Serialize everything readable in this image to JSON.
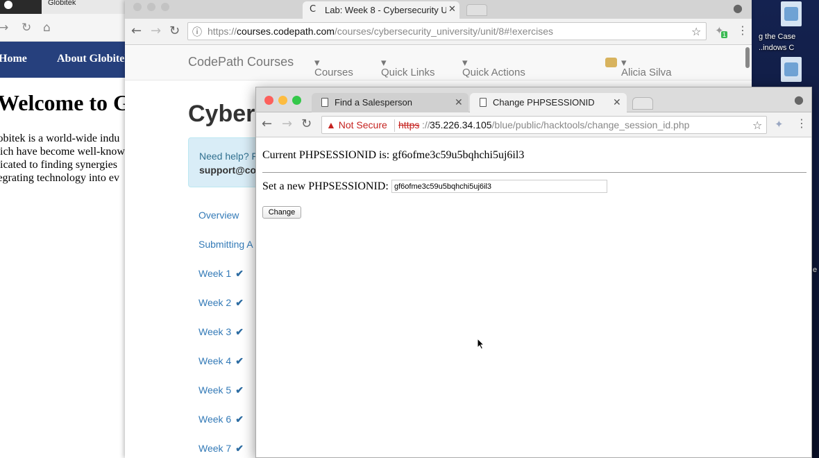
{
  "globitek": {
    "tab_title": "Globitek",
    "nav_home": "Home",
    "nav_about": "About Globitek",
    "heading": "Welcome to G",
    "paragraph_lines": [
      "lobitek is a world-wide indu",
      "hich have become well-know",
      "dicated to finding synergies",
      "tegrating technology into ev"
    ]
  },
  "codepath": {
    "tab_title": "Lab: Week 8 - Cybersecurity U",
    "url_prefix": "https://",
    "url_host": "courses.codepath.com",
    "url_path": "/courses/cybersecurity_university/unit/8#!exercises",
    "extension_badge": "1",
    "nav": {
      "brand": "CodePath Courses",
      "courses": "Courses",
      "quick_links": "Quick Links",
      "quick_actions": "Quick Actions",
      "user": "Alicia Silva"
    },
    "page_title": "Cyber",
    "help_line1": "Need help? F",
    "help_line2": "support@coc",
    "sidebar": [
      {
        "label": "Overview",
        "done": false
      },
      {
        "label": "Submitting A",
        "done": false
      },
      {
        "label": "Week 1",
        "done": true
      },
      {
        "label": "Week 2",
        "done": true
      },
      {
        "label": "Week 3",
        "done": true
      },
      {
        "label": "Week 4",
        "done": true
      },
      {
        "label": "Week 5",
        "done": true
      },
      {
        "label": "Week 6",
        "done": true
      },
      {
        "label": "Week 7",
        "done": true
      }
    ]
  },
  "front": {
    "tabs": [
      {
        "title": "Find a Salesperson",
        "active": false
      },
      {
        "title": "Change PHPSESSIONID",
        "active": true
      }
    ],
    "security_label": "Not Secure",
    "url_protocol": "https",
    "url_sep": "://",
    "url_host": "35.226.34.105",
    "url_path": "/blue/public/hacktools/change_session_id.php",
    "current_label": "Current PHPSESSIONID is: gf6ofme3c59u5bqhchi5uj6il3",
    "set_label": "Set a new PHPSESSIONID:",
    "session_input_value": "gf6ofme3c59u5bqhchi5uj6il3",
    "change_button": "Change"
  },
  "desktop": {
    "label1": "g the Case",
    "label2": "..indows C",
    "label3": "e"
  },
  "colors": {
    "globitek_nav": "#26407d",
    "link_blue": "#337ab7",
    "alert_bg": "#d9edf7",
    "not_secure_red": "#c5221f"
  }
}
